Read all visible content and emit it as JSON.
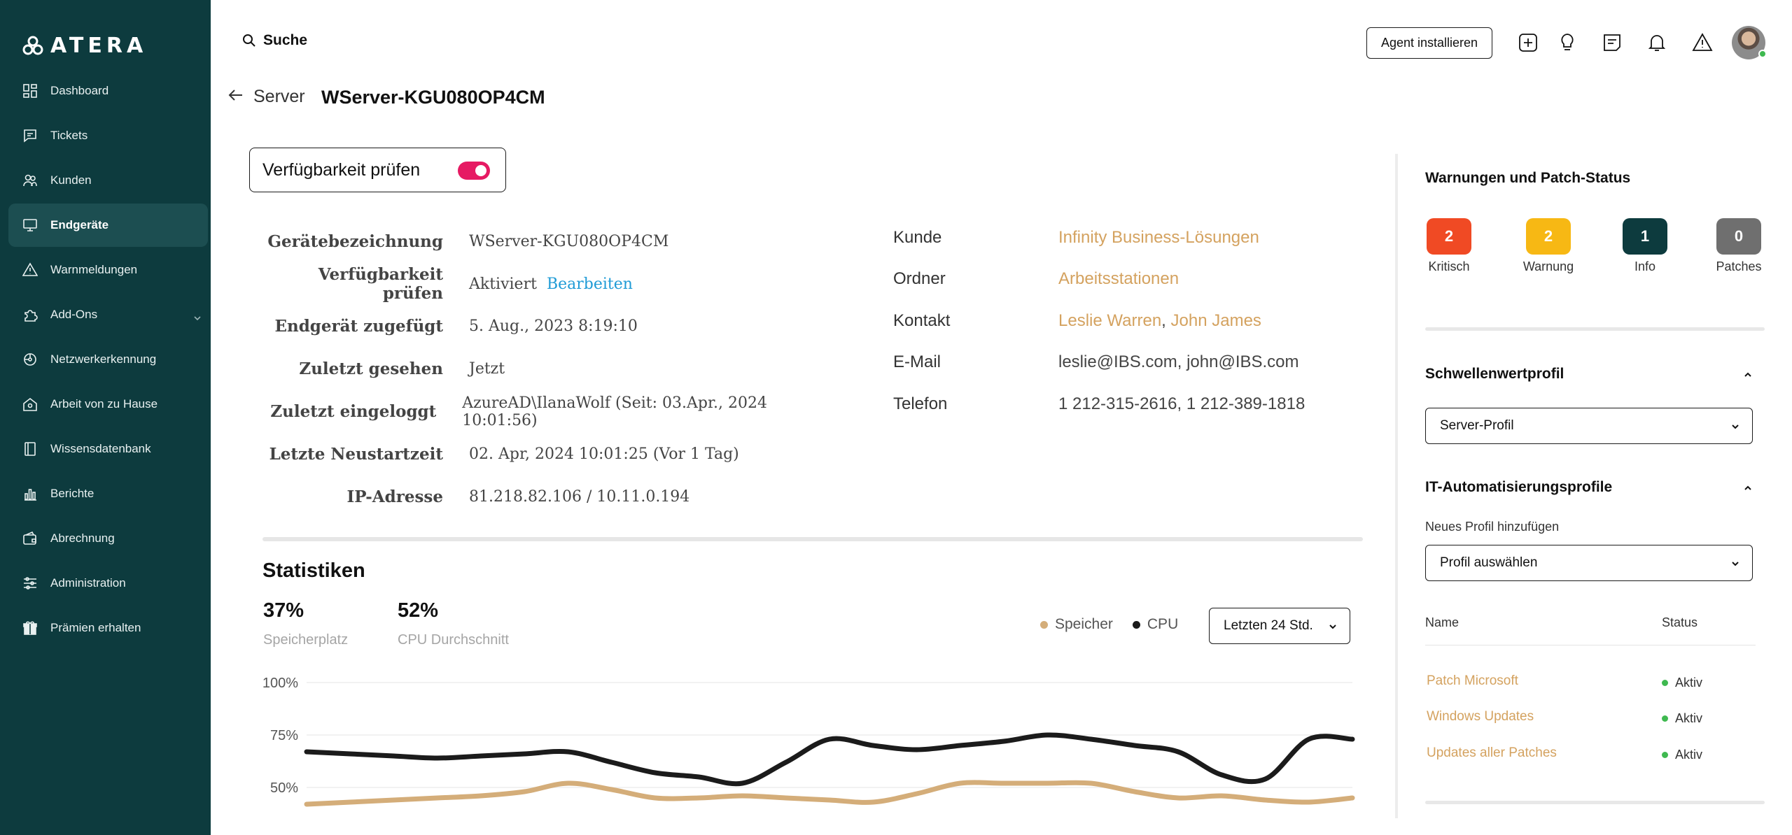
{
  "brand": {
    "name": "ATERA"
  },
  "sidebar": {
    "items": [
      {
        "label": "Dashboard",
        "icon": "dashboard-icon",
        "active": false
      },
      {
        "label": "Tickets",
        "icon": "ticket-icon",
        "active": false
      },
      {
        "label": "Kunden",
        "icon": "customers-icon",
        "active": false
      },
      {
        "label": "Endgeräte",
        "icon": "devices-icon",
        "active": true
      },
      {
        "label": "Warnmeldungen",
        "icon": "alert-icon",
        "active": false
      },
      {
        "label": "Add-Ons",
        "icon": "addons-icon",
        "active": false,
        "expandable": true
      },
      {
        "label": "Netzwerkerkennung",
        "icon": "network-icon",
        "active": false
      },
      {
        "label": "Arbeit von zu Hause",
        "icon": "home-icon",
        "active": false
      },
      {
        "label": "Wissensdatenbank",
        "icon": "knowledge-icon",
        "active": false
      },
      {
        "label": "Berichte",
        "icon": "reports-icon",
        "active": false
      },
      {
        "label": "Abrechnung",
        "icon": "billing-icon",
        "active": false
      },
      {
        "label": "Administration",
        "icon": "admin-icon",
        "active": false
      },
      {
        "label": "Prämien erhalten",
        "icon": "gift-icon",
        "active": false
      }
    ]
  },
  "topbar": {
    "search_label": "Suche",
    "agent_button": "Agent installieren"
  },
  "breadcrumb": {
    "parent": "Server"
  },
  "page": {
    "title": "WServer-KGU080OP4CM"
  },
  "availability": {
    "label": "Verfügbarkeit prüfen",
    "enabled": true
  },
  "device": {
    "rows": [
      {
        "label": "Gerätebezeichnung",
        "value": "WServer-KGU080OP4CM"
      },
      {
        "label": "Verfügbarkeit prüfen",
        "value": "Aktiviert",
        "link": "Bearbeiten"
      },
      {
        "label": "Endgerät zugefügt",
        "value": "5. Aug., 2023 8:19:10"
      },
      {
        "label": "Zuletzt gesehen",
        "value": "Jetzt"
      },
      {
        "label": "Zuletzt eingeloggt",
        "value": "AzureAD\\IlanaWolf (Seit: 03.Apr., 2024 10:01:56)"
      },
      {
        "label": "Letzte Neustartzeit",
        "value": "02. Apr, 2024 10:01:25 (Vor 1 Tag)"
      },
      {
        "label": "IP-Adresse",
        "value": "81.218.82.106 / 10.11.0.194"
      }
    ]
  },
  "contacts": {
    "rows": [
      {
        "label": "Kunde",
        "value": "Infinity Business-Lösungen"
      },
      {
        "label": "Ordner",
        "value": "Arbeitsstationen"
      },
      {
        "label": "Kontakt",
        "value1": "Leslie Warren",
        "sep": ", ",
        "value2": "John James"
      },
      {
        "label": "E-Mail",
        "value": "leslie@IBS.com, john@IBS.com"
      },
      {
        "label": "Telefon",
        "value": "1 212-315-2616, 1 212-389-1818"
      }
    ]
  },
  "stats": {
    "title": "Statistiken",
    "storage": {
      "value": "37%",
      "label": "Speicherplatz"
    },
    "cpu": {
      "value": "52%",
      "label": "CPU Durchschnitt"
    },
    "legend": {
      "memory": "Speicher",
      "cpu": "CPU"
    },
    "range": "Letzten 24 Std."
  },
  "chart_data": {
    "type": "line",
    "title": "",
    "xlabel": "",
    "ylabel": "",
    "yticks": [
      "100%",
      "75%",
      "50%"
    ],
    "ylim": [
      36,
      100
    ],
    "grid": true,
    "legend_placement": "top-right",
    "x": [
      0,
      1,
      2,
      3,
      4,
      5,
      6,
      7,
      8,
      9,
      10,
      11,
      12,
      13,
      14,
      15,
      16,
      17,
      18,
      19,
      20,
      21,
      22,
      23,
      24
    ],
    "series": [
      {
        "name": "CPU",
        "color": "#1b1b1b",
        "values": [
          67,
          66,
          65,
          64,
          65,
          66,
          67,
          62,
          57,
          55,
          52,
          62,
          73,
          70,
          68,
          70,
          72,
          75,
          73,
          70,
          67,
          56,
          54,
          73,
          73
        ]
      },
      {
        "name": "Speicher",
        "color": "#d4ad79",
        "values": [
          42,
          43,
          44,
          45,
          46,
          48,
          52,
          49,
          45,
          45,
          46,
          45,
          44,
          43,
          47,
          52,
          52,
          52,
          52,
          48,
          45,
          46,
          44,
          43,
          45
        ]
      }
    ]
  },
  "rightpanel": {
    "title": "Warnungen und Patch-Status",
    "badges": [
      {
        "count": "2",
        "label": "Kritisch",
        "color": "#f04a24"
      },
      {
        "count": "2",
        "label": "Warnung",
        "color": "#f7b814"
      },
      {
        "count": "1",
        "label": "Info",
        "color": "#0d3b3e"
      },
      {
        "count": "0",
        "label": "Patches",
        "color": "#6f6f6f"
      }
    ],
    "threshold": {
      "title": "Schwellenwertprofil",
      "selected": "Server-Profil"
    },
    "automation": {
      "title": "IT-Automatisierungsprofile",
      "add_label": "Neues Profil hinzufügen",
      "select_placeholder": "Profil auswählen",
      "col_name": "Name",
      "col_status": "Status",
      "profiles": [
        {
          "name": "Patch Microsoft",
          "status": "Aktiv"
        },
        {
          "name": "Windows Updates",
          "status": "Aktiv"
        },
        {
          "name": "Updates aller Patches",
          "status": "Aktiv"
        }
      ]
    }
  }
}
